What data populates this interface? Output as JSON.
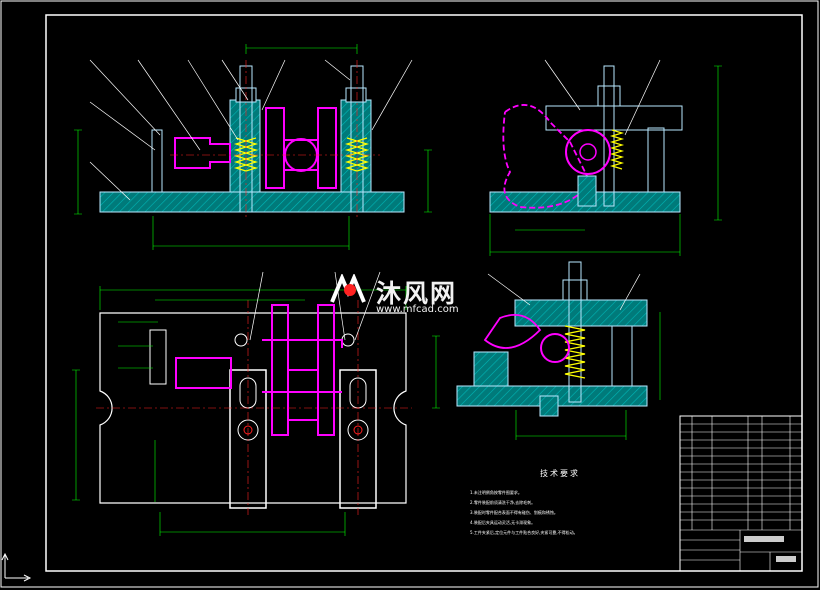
{
  "watermark": {
    "brand_cn": "沐风网",
    "url": "www.mfcad.com"
  },
  "technical_requirements": {
    "title": "技术要求",
    "items": [
      "1.未注明倒角按零件图要求。",
      "2.零件装配前须清洗干净,去除毛刺。",
      "3.装配时零件配合表面不得有碰伤、划痕和锈蚀。",
      "4.装配后夹具运动灵活,无卡滞现象。",
      "5.工件夹紧后,定位元件与工件贴合良好,夹紧可靠,不得松动。"
    ]
  },
  "colors": {
    "background": "#000000",
    "frame": "#ffffff",
    "dimension": "#00ff00",
    "hatch_fill": "#008c8c",
    "part_outline": "#b8e8ff",
    "workpiece": "#ff00ff",
    "spring": "#ffff00",
    "center_line": "#ff2020"
  }
}
